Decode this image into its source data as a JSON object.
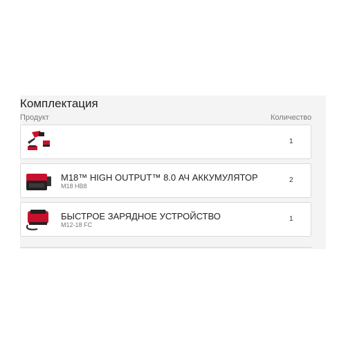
{
  "section": {
    "title": "Комплектация",
    "col_product": "Продукт",
    "col_quantity": "Количество"
  },
  "items": [
    {
      "name": "",
      "sku": "",
      "quantity": "1",
      "image": "blower-kit-icon"
    },
    {
      "name": "M18™ HIGH OUTPUT™ 8.0 АЧ АККУМУЛЯТОР",
      "sku": "M18 HB8",
      "quantity": "2",
      "image": "battery-icon"
    },
    {
      "name": "БЫСТРОЕ ЗАРЯДНОЕ УСТРОЙСТВО",
      "sku": "M12-18 FC",
      "quantity": "1",
      "image": "charger-icon"
    }
  ],
  "colors": {
    "brand_red": "#c8102e",
    "panel_bg": "#f4f4f4",
    "border": "#d9d9d9"
  }
}
